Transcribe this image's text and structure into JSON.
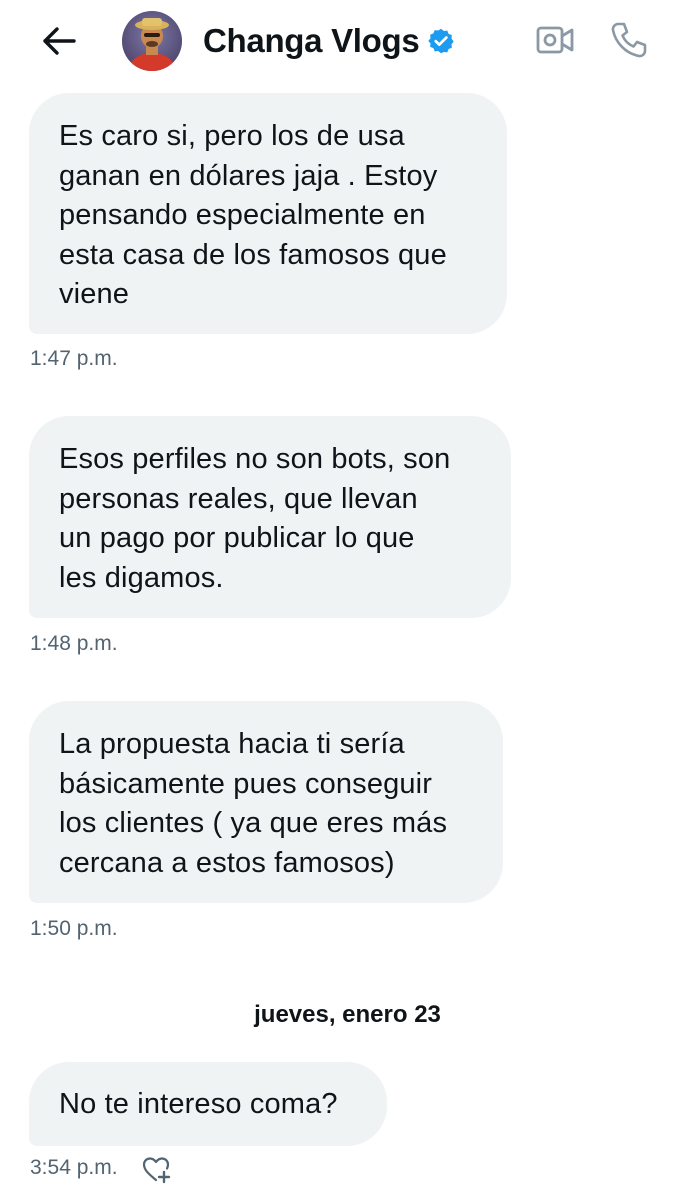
{
  "header": {
    "back_icon": "arrow-left-icon",
    "title": "Changa Vlogs",
    "verified_icon": "verified-badge-icon",
    "verified_color": "#1d9bf0",
    "video_icon": "video-camera-icon",
    "call_icon": "phone-icon"
  },
  "messages": [
    {
      "lines": [
        "Es caro si, pero los de usa",
        "ganan en dólares jaja . Estoy",
        "pensando especialmente en",
        "esta casa de los famosos que",
        "viene"
      ],
      "time": "1:47 p.m."
    },
    {
      "lines": [
        "Esos perfiles no son bots, son",
        "personas reales, que llevan",
        "un pago por publicar lo que",
        "les digamos."
      ],
      "time": "1:48 p.m."
    },
    {
      "lines": [
        "La propuesta hacia ti sería",
        "básicamente pues conseguir",
        "los clientes ( ya que eres más",
        "cercana a estos famosos)"
      ],
      "time": "1:50 p.m."
    },
    {
      "lines": [
        "No te intereso coma?"
      ],
      "time": "3:54 p.m."
    }
  ],
  "date_divider": "jueves, enero 23",
  "react_icon": "heart-plus-icon",
  "colors": {
    "bubble_bg": "#eff3f4",
    "text": "#0f1419",
    "muted": "#536471"
  }
}
